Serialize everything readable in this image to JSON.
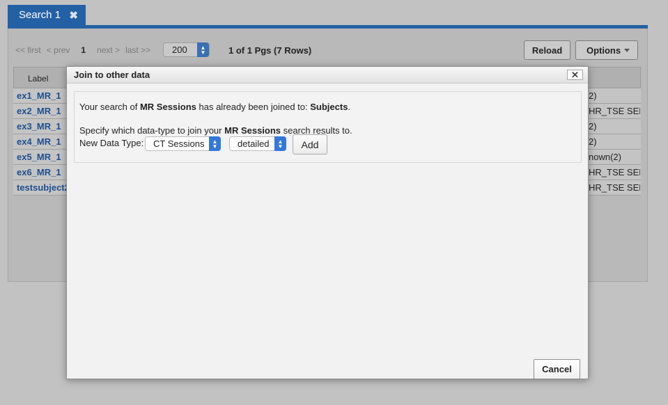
{
  "tab": {
    "label": "Search 1",
    "close_glyph": "✖",
    "close_icon": "close-icon"
  },
  "pager": {
    "first": "<< first",
    "prev": "< prev",
    "page": "1",
    "next": "next >",
    "last": "last >>",
    "rows_per_page": "200",
    "page_info": "1 of 1 Pgs (7 Rows)"
  },
  "toolbar": {
    "reload_label": "Reload",
    "options_label": "Options"
  },
  "table": {
    "header_label": "Label",
    "rows": [
      {
        "label": "ex1_MR_1",
        "right": "2)"
      },
      {
        "label": "ex2_MR_1",
        "right": "HR_TSE SEN"
      },
      {
        "label": "ex3_MR_1",
        "right": "2)"
      },
      {
        "label": "ex4_MR_1",
        "right": "2)"
      },
      {
        "label": "ex5_MR_1",
        "right": "nown(2)"
      },
      {
        "label": "ex6_MR_1",
        "right": "HR_TSE SEN"
      },
      {
        "label": "testsubject2",
        "right": "HR_TSE SEN"
      }
    ]
  },
  "modal": {
    "title": "Join to other data",
    "close_glyph": "✕",
    "line1_prefix": "Your search of ",
    "line1_entity": "MR Sessions",
    "line1_middle": " has already been joined to: ",
    "line1_joined": "Subjects",
    "line1_suffix": ".",
    "line2_prefix": "Specify which data-type to join your ",
    "line2_entity": "MR Sessions",
    "line2_suffix": " search results to.",
    "data_type_label": "New Data Type:",
    "data_type_value": "CT Sessions",
    "detail_value": "detailed",
    "add_label": "Add",
    "cancel_label": "Cancel"
  },
  "colors": {
    "tab_blue": "#2461a4",
    "link_blue": "#1f4f8c",
    "select_stepper": "#3478d9"
  }
}
